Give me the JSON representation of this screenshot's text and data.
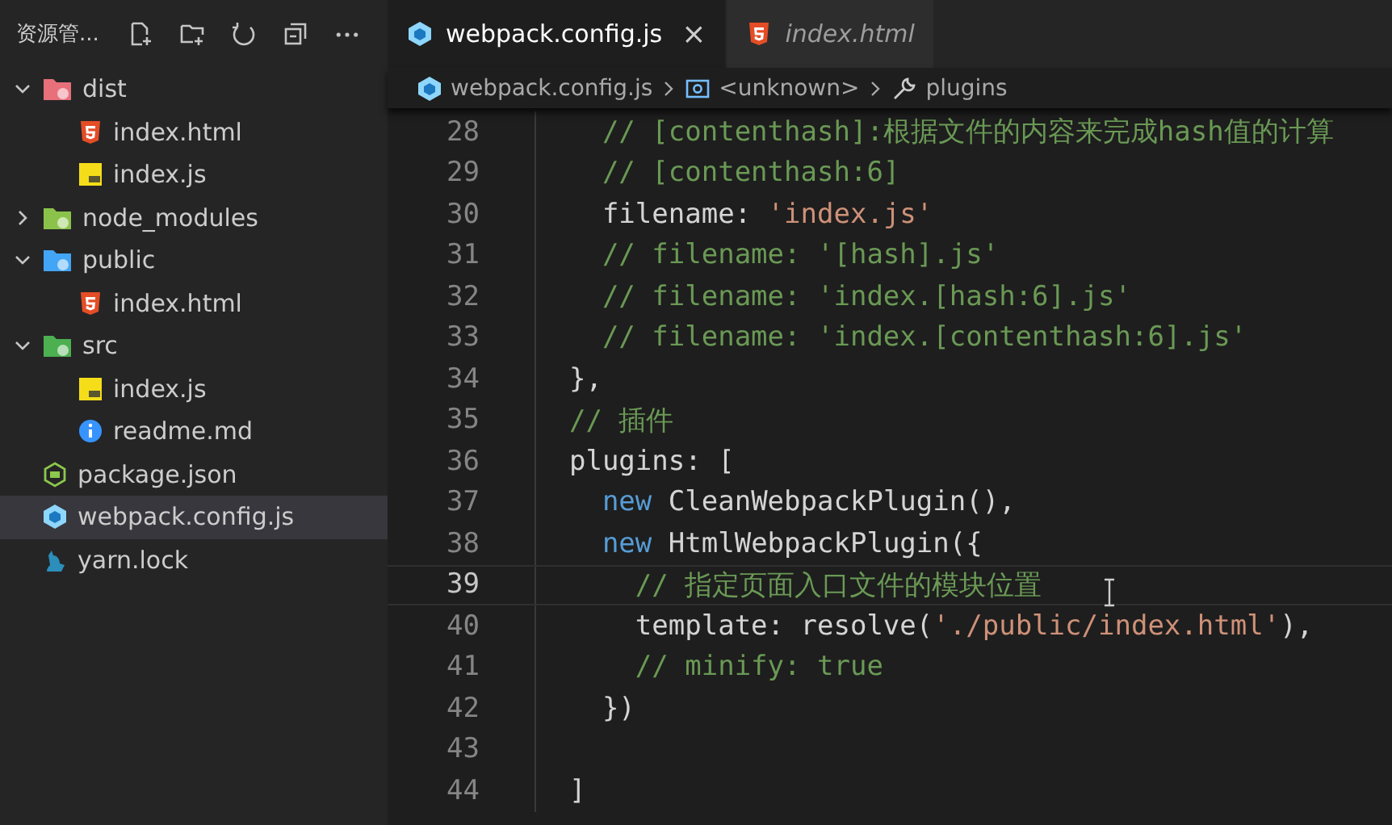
{
  "explorer": {
    "title": "资源管...",
    "actions": [
      {
        "kind": "new-file"
      },
      {
        "kind": "new-folder"
      },
      {
        "kind": "refresh"
      },
      {
        "kind": "collapse"
      },
      {
        "kind": "more"
      }
    ],
    "tree": [
      {
        "label": "dist",
        "kind": "folder-dist",
        "expanded": true,
        "selected": false,
        "children": [
          {
            "label": "index.html",
            "kind": "html",
            "selected": false
          },
          {
            "label": "index.js",
            "kind": "js",
            "selected": false
          }
        ]
      },
      {
        "label": "node_modules",
        "kind": "folder-node",
        "expanded": false,
        "selected": false
      },
      {
        "label": "public",
        "kind": "folder-public",
        "expanded": true,
        "selected": false,
        "children": [
          {
            "label": "index.html",
            "kind": "html",
            "selected": false
          }
        ]
      },
      {
        "label": "src",
        "kind": "folder-src",
        "expanded": true,
        "selected": false,
        "children": [
          {
            "label": "index.js",
            "kind": "js",
            "selected": false
          },
          {
            "label": "readme.md",
            "kind": "info",
            "selected": false
          }
        ]
      },
      {
        "label": "package.json",
        "kind": "nodejs",
        "selected": false
      },
      {
        "label": "webpack.config.js",
        "kind": "webpack",
        "selected": true
      },
      {
        "label": "yarn.lock",
        "kind": "yarn",
        "selected": false
      }
    ]
  },
  "tabs": [
    {
      "label": "webpack.config.js",
      "kind": "webpack",
      "selected": true,
      "preview": false,
      "close": "×"
    },
    {
      "label": "index.html",
      "kind": "html",
      "selected": false,
      "preview": true
    }
  ],
  "breadcrumb": [
    {
      "label": "webpack.config.js",
      "kind": "webpack"
    },
    {
      "label": "<unknown>",
      "kind": "variable"
    },
    {
      "label": "plugins",
      "kind": "wrench"
    }
  ],
  "code": [
    {
      "number": "28",
      "current": false,
      "tokens": [
        {
          "kind": "comment",
          "text": "    // [contenthash]:根据文件的内容来完成hash值的计算"
        }
      ]
    },
    {
      "number": "29",
      "current": false,
      "tokens": [
        {
          "kind": "comment",
          "text": "    // [contenthash:6]"
        }
      ]
    },
    {
      "number": "30",
      "current": false,
      "tokens": [
        {
          "kind": "plain",
          "text": "    filename: "
        },
        {
          "kind": "string",
          "text": "'index.js'"
        }
      ]
    },
    {
      "number": "31",
      "current": false,
      "tokens": [
        {
          "kind": "comment",
          "text": "    // filename: '[hash].js'"
        }
      ]
    },
    {
      "number": "32",
      "current": false,
      "tokens": [
        {
          "kind": "comment",
          "text": "    // filename: 'index.[hash:6].js'"
        }
      ]
    },
    {
      "number": "33",
      "current": false,
      "tokens": [
        {
          "kind": "comment",
          "text": "    // filename: 'index.[contenthash:6].js'"
        }
      ]
    },
    {
      "number": "34",
      "current": false,
      "tokens": [
        {
          "kind": "plain",
          "text": "  },"
        }
      ]
    },
    {
      "number": "35",
      "current": false,
      "tokens": [
        {
          "kind": "comment",
          "text": "  // 插件"
        }
      ]
    },
    {
      "number": "36",
      "current": false,
      "tokens": [
        {
          "kind": "plain",
          "text": "  plugins: ["
        }
      ]
    },
    {
      "number": "37",
      "current": false,
      "tokens": [
        {
          "kind": "keyword",
          "text": "    new"
        },
        {
          "kind": "plain",
          "text": " CleanWebpackPlugin(),"
        }
      ]
    },
    {
      "number": "38",
      "current": false,
      "tokens": [
        {
          "kind": "keyword",
          "text": "    new"
        },
        {
          "kind": "plain",
          "text": " HtmlWebpackPlugin({"
        }
      ]
    },
    {
      "number": "39",
      "current": true,
      "tokens": [
        {
          "kind": "comment",
          "text": "      // 指定页面入口文件的模块位置"
        }
      ]
    },
    {
      "number": "40",
      "current": false,
      "tokens": [
        {
          "kind": "plain",
          "text": "      template: resolve("
        },
        {
          "kind": "string",
          "text": "'./public/index.html'"
        },
        {
          "kind": "plain",
          "text": "),"
        }
      ]
    },
    {
      "number": "41",
      "current": false,
      "tokens": [
        {
          "kind": "comment",
          "text": "      // minify: true"
        }
      ]
    },
    {
      "number": "42",
      "current": false,
      "tokens": [
        {
          "kind": "plain",
          "text": "    })"
        }
      ]
    },
    {
      "number": "43",
      "current": false
    },
    {
      "number": "44",
      "current": false,
      "tokens": [
        {
          "kind": "plain",
          "text": "  ]"
        }
      ]
    }
  ]
}
